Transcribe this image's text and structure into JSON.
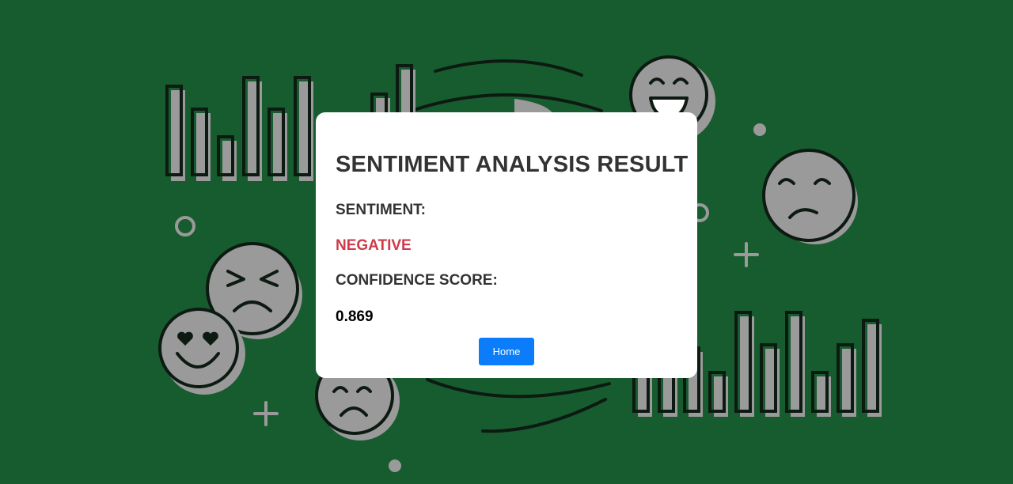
{
  "result": {
    "title": "SENTIMENT ANALYSIS RESULT",
    "sentiment_label": "SENTIMENT:",
    "sentiment_value": "NEGATIVE",
    "confidence_label": "CONFIDENCE SCORE:",
    "confidence_value": "0.869",
    "home_button_label": "Home"
  },
  "colors": {
    "background": "#175c2e",
    "card": "#ffffff",
    "negative": "#d13a4a",
    "button": "#0b7dfb",
    "illustration_gray": "#9a9a9a"
  },
  "background_illustration": {
    "icons": [
      "bar-chart-icon",
      "laughing-face-icon",
      "sad-face-icon",
      "angry-face-icon",
      "heart-eyes-face-icon",
      "frowning-face-icon",
      "plus-sign-icon",
      "circle-icon"
    ]
  }
}
